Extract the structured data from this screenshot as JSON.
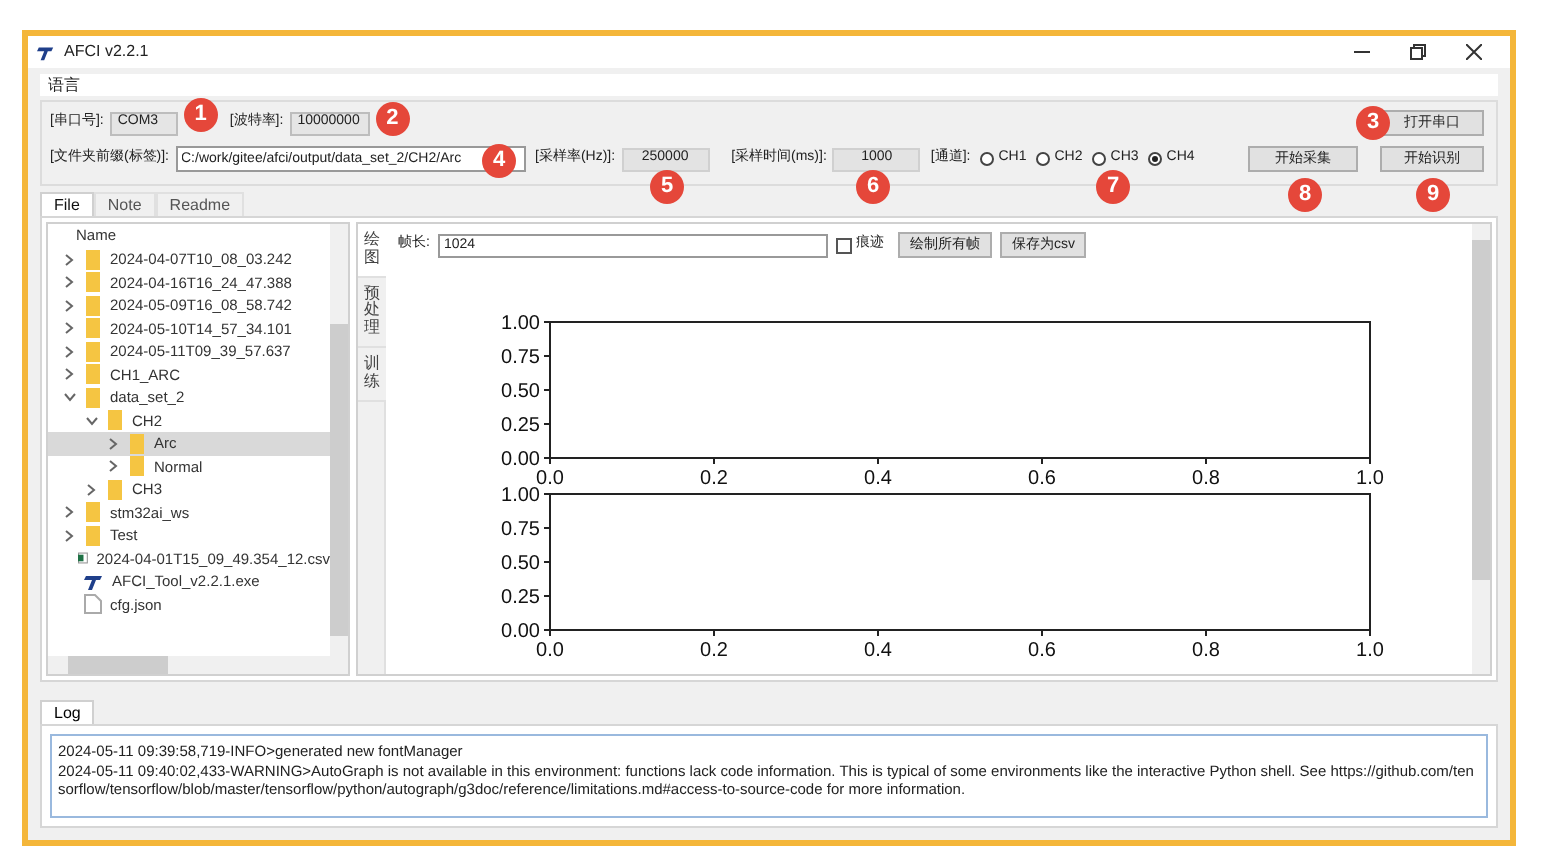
{
  "window": {
    "title": "AFCI v2.2.1"
  },
  "menu": [
    "语言"
  ],
  "serial": {
    "port_label": "[串口号]:",
    "port_value": "COM3",
    "baud_label": "[波特率]:",
    "baud_value": "10000000",
    "open_button": "打开串口"
  },
  "capture": {
    "prefix_label": "[文件夹前缀(标签)]:",
    "prefix_value": "C:/work/gitee/afci/output/data_set_2/CH2/Arc",
    "rate_label": "[采样率(Hz)]:",
    "rate_value": "250000",
    "time_label": "[采样时间(ms)]:",
    "time_value": "1000",
    "channel_label": "[通道]:",
    "channels": [
      {
        "label": "CH1",
        "selected": false
      },
      {
        "label": "CH2",
        "selected": false
      },
      {
        "label": "CH3",
        "selected": false
      },
      {
        "label": "CH4",
        "selected": true
      }
    ],
    "start_button": "开始采集",
    "recognize_button": "开始识别"
  },
  "badges": [
    "1",
    "2",
    "3",
    "4",
    "5",
    "6",
    "7",
    "8",
    "9"
  ],
  "tabs": [
    {
      "label": "File",
      "selected": true
    },
    {
      "label": "Note",
      "selected": false
    },
    {
      "label": "Readme",
      "selected": false
    }
  ],
  "tree": {
    "header": "Name",
    "items": [
      {
        "name": "2024-04-07T10_08_03.242",
        "kind": "folder",
        "expanded": false,
        "selected": false
      },
      {
        "name": "2024-04-16T16_24_47.388",
        "kind": "folder",
        "expanded": false,
        "selected": false
      },
      {
        "name": "2024-05-09T16_08_58.742",
        "kind": "folder",
        "expanded": false,
        "selected": false
      },
      {
        "name": "2024-05-10T14_57_34.101",
        "kind": "folder",
        "expanded": false,
        "selected": false
      },
      {
        "name": "2024-05-11T09_39_57.637",
        "kind": "folder",
        "expanded": false,
        "selected": false
      },
      {
        "name": "CH1_ARC",
        "kind": "folder",
        "expanded": false,
        "selected": false
      },
      {
        "name": "data_set_2",
        "kind": "folder",
        "expanded": true,
        "selected": false,
        "children": [
          {
            "name": "CH2",
            "kind": "folder",
            "expanded": true,
            "selected": false,
            "children": [
              {
                "name": "Arc",
                "kind": "folder",
                "expanded": false,
                "selected": true
              },
              {
                "name": "Normal",
                "kind": "folder",
                "expanded": false,
                "selected": false
              }
            ]
          },
          {
            "name": "CH3",
            "kind": "folder",
            "expanded": false,
            "selected": false
          }
        ]
      },
      {
        "name": "stm32ai_ws",
        "kind": "folder",
        "expanded": false,
        "selected": false
      },
      {
        "name": "Test",
        "kind": "folder",
        "expanded": false,
        "selected": false
      },
      {
        "name": "2024-04-01T15_09_49.354_12.csv",
        "kind": "csv"
      },
      {
        "name": "AFCI_Tool_v2.2.1.exe",
        "kind": "exe"
      },
      {
        "name": "cfg.json",
        "kind": "json"
      }
    ]
  },
  "side_tabs": [
    {
      "label": "绘图",
      "selected": true
    },
    {
      "label": "预处理",
      "selected": false
    },
    {
      "label": "训练",
      "selected": false
    }
  ],
  "plot": {
    "frame_label": "帧长:",
    "frame_value": "1024",
    "trace_label": "痕迹",
    "trace_checked": false,
    "draw_all_button": "绘制所有帧",
    "save_button": "保存为csv",
    "charts": [
      {
        "chart_data": {
          "type": "line",
          "xlim": [
            0,
            1
          ],
          "ylim": [
            0,
            1
          ],
          "xticks": [
            {
              "value": 0,
              "label": "0.0"
            },
            {
              "value": 0.2,
              "label": "0.2"
            },
            {
              "value": 0.4,
              "label": "0.4"
            },
            {
              "value": 0.6,
              "label": "0.6"
            },
            {
              "value": 0.8,
              "label": "0.8"
            },
            {
              "value": 1,
              "label": "1.0"
            }
          ],
          "yticks": [
            {
              "value": 0,
              "label": "0.00"
            },
            {
              "value": 0.25,
              "label": "0.25"
            },
            {
              "value": 0.5,
              "label": "0.50"
            },
            {
              "value": 0.75,
              "label": "0.75"
            },
            {
              "value": 1,
              "label": "1.00"
            }
          ]
        }
      },
      {
        "chart_data": {
          "type": "line",
          "xlim": [
            0,
            1
          ],
          "ylim": [
            0,
            1
          ],
          "xticks": [
            {
              "value": 0,
              "label": "0.0"
            },
            {
              "value": 0.2,
              "label": "0.2"
            },
            {
              "value": 0.4,
              "label": "0.4"
            },
            {
              "value": 0.6,
              "label": "0.6"
            },
            {
              "value": 0.8,
              "label": "0.8"
            },
            {
              "value": 1,
              "label": "1.0"
            }
          ],
          "yticks": [
            {
              "value": 0,
              "label": "0.00"
            },
            {
              "value": 0.25,
              "label": "0.25"
            },
            {
              "value": 0.5,
              "label": "0.50"
            },
            {
              "value": 0.75,
              "label": "0.75"
            },
            {
              "value": 1,
              "label": "1.00"
            }
          ]
        }
      }
    ]
  },
  "log": {
    "tab": "Log",
    "lines": [
      "2024-05-11 09:39:58,719-INFO>generated new fontManager",
      "2024-05-11 09:40:02,433-WARNING>AutoGraph is not available in this environment: functions lack code information. This is typical of some environments like the interactive Python shell. See https://github.com/tensorflow/tensorflow/blob/master/tensorflow/python/autograph/g3doc/reference/limitations.md#access-to-source-code for more information."
    ]
  }
}
